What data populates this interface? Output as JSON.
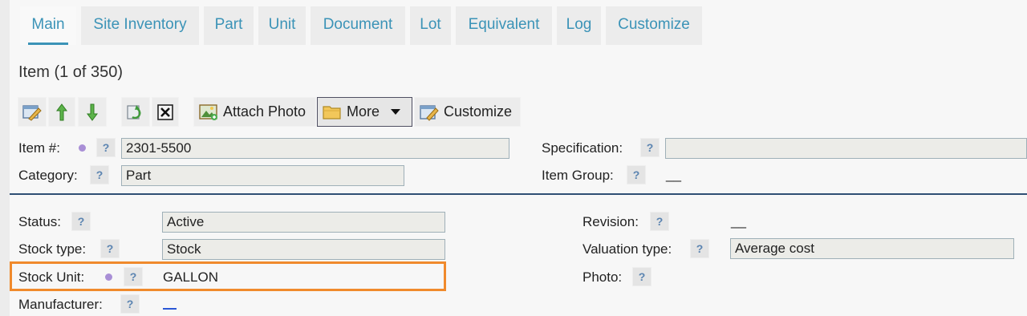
{
  "tabs": [
    {
      "label": "Main"
    },
    {
      "label": "Site Inventory"
    },
    {
      "label": "Part"
    },
    {
      "label": "Unit"
    },
    {
      "label": "Document"
    },
    {
      "label": "Lot"
    },
    {
      "label": "Equivalent"
    },
    {
      "label": "Log"
    },
    {
      "label": "Customize"
    }
  ],
  "active_tab": "Main",
  "title": "Item (1 of 350)",
  "toolbar": {
    "attach_photo": "Attach Photo",
    "more": "More",
    "customize": "Customize",
    "icons": [
      "edit-icon",
      "move-up-icon",
      "move-down-icon",
      "refresh-icon",
      "delete-icon",
      "photo-icon",
      "folder-icon",
      "dropdown-arrow-icon",
      "customize-icon"
    ]
  },
  "help_glyph": "?",
  "fields": {
    "item_no": {
      "label": "Item #:",
      "value": "2301-5500"
    },
    "category": {
      "label": "Category:",
      "value": "Part"
    },
    "specification": {
      "label": "Specification:",
      "value": ""
    },
    "item_group": {
      "label": "Item Group:",
      "value": "__"
    },
    "status": {
      "label": "Status:",
      "value": "Active"
    },
    "stock_type": {
      "label": "Stock type:",
      "value": "Stock"
    },
    "stock_unit": {
      "label": "Stock Unit:",
      "value": "GALLON"
    },
    "manufacturer": {
      "label": "Manufacturer:",
      "value": "__"
    },
    "revision": {
      "label": "Revision:",
      "value": "__"
    },
    "valuation_type": {
      "label": "Valuation type:",
      "value": "Average cost"
    },
    "photo": {
      "label": "Photo:",
      "value": ""
    }
  },
  "colors": {
    "tab_text": "#3b93b7",
    "highlight": "#f08a2c",
    "required_dot": "#a98fd6",
    "divider": "#2f4f74"
  }
}
